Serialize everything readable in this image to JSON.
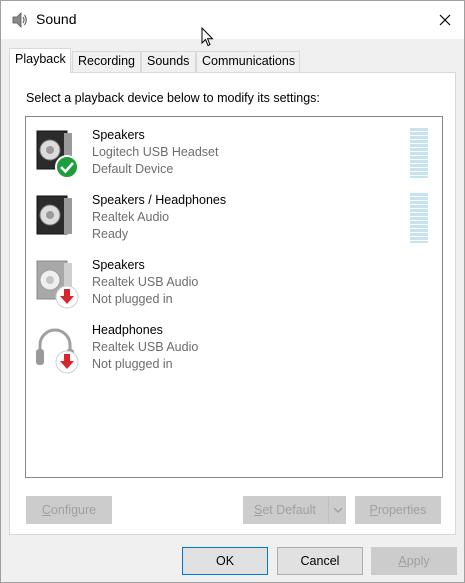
{
  "window": {
    "title": "Sound",
    "close_glyph": "✕"
  },
  "tabs": [
    {
      "label": "Playback",
      "active": true
    },
    {
      "label": "Recording",
      "active": false
    },
    {
      "label": "Sounds",
      "active": false
    },
    {
      "label": "Communications",
      "active": false
    }
  ],
  "playback": {
    "instruction": "Select a playback device below to modify its settings:",
    "devices": [
      {
        "name": "Speakers",
        "sub": "Logitech USB Headset",
        "status": "Default Device",
        "icon": "speaker-default-icon",
        "badge": "green-check",
        "meter": true
      },
      {
        "name": "Speakers / Headphones",
        "sub": "Realtek Audio",
        "status": "Ready",
        "icon": "speaker-icon",
        "badge": "none",
        "meter": true
      },
      {
        "name": "Speakers",
        "sub": "Realtek USB Audio",
        "status": "Not plugged in",
        "icon": "speaker-unplugged-icon",
        "badge": "red-down-arrow",
        "meter": false
      },
      {
        "name": "Headphones",
        "sub": "Realtek USB Audio",
        "status": "Not plugged in",
        "icon": "headphones-unplugged-icon",
        "badge": "red-down-arrow",
        "meter": false
      }
    ]
  },
  "panel_buttons": {
    "configure": {
      "first": "C",
      "rest": "onfigure"
    },
    "set_default": {
      "first": "S",
      "rest": "et Default"
    },
    "properties": {
      "first": "P",
      "rest": "roperties"
    }
  },
  "dialog_buttons": {
    "ok": "OK",
    "cancel": "Cancel",
    "apply": {
      "first": "A",
      "rest": "pply"
    }
  },
  "colors": {
    "accent": "#0078d7",
    "badge_green": "#1e9e3a",
    "badge_red": "#d9262c",
    "meter": "#c6e4ef"
  }
}
